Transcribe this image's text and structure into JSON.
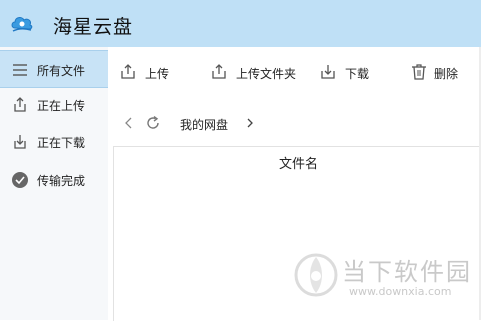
{
  "app": {
    "title": "海星云盘",
    "logo_icon": "cloud-logo-icon"
  },
  "colors": {
    "titlebar": "#bfe0f6",
    "sidebar_active": "#c8e3f6",
    "icon": "#555555"
  },
  "sidebar": {
    "items": [
      {
        "label": "所有文件",
        "icon": "menu-icon",
        "active": true
      },
      {
        "label": "正在上传",
        "icon": "upload-icon",
        "active": false
      },
      {
        "label": "正在下载",
        "icon": "download-icon",
        "active": false
      },
      {
        "label": "传输完成",
        "icon": "check-circle-icon",
        "active": false
      }
    ]
  },
  "toolbar": {
    "upload_label": "上传",
    "upload_folder_label": "上传文件夹",
    "download_label": "下载",
    "delete_label": "删除"
  },
  "nav": {
    "breadcrumb": "我的网盘"
  },
  "file_list": {
    "column_header": "文件名"
  },
  "watermark": {
    "name": "当下软件园",
    "url": "www.downxia.com"
  }
}
